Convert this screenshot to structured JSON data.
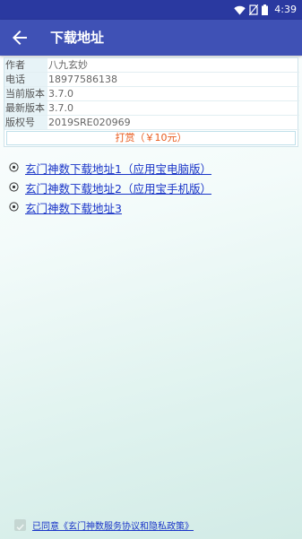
{
  "status_bar": {
    "time": "4:39"
  },
  "app_bar": {
    "title": "下载地址"
  },
  "info": {
    "rows": [
      {
        "label": "作者",
        "value": "八九玄妙"
      },
      {
        "label": "电话",
        "value": "18977586138"
      },
      {
        "label": "当前版本",
        "value": "3.7.0"
      },
      {
        "label": "最新版本",
        "value": "3.7.0"
      },
      {
        "label": "版权号",
        "value": "2019SRE020969"
      }
    ],
    "reward": "打赏（￥10元）"
  },
  "downloads": [
    {
      "label": "玄门神数下载地址1（应用宝电脑版）"
    },
    {
      "label": "玄门神数下载地址2（应用宝手机版）"
    },
    {
      "label": "玄门神数下载地址3"
    }
  ],
  "agreement": {
    "label": "已同意《玄门神数服务协议和隐私政策》",
    "checked": true
  },
  "colors": {
    "status_bar": "#2a39a0",
    "app_bar": "#3f51b5",
    "link": "#1a35c8",
    "reward": "#e85a1c"
  }
}
